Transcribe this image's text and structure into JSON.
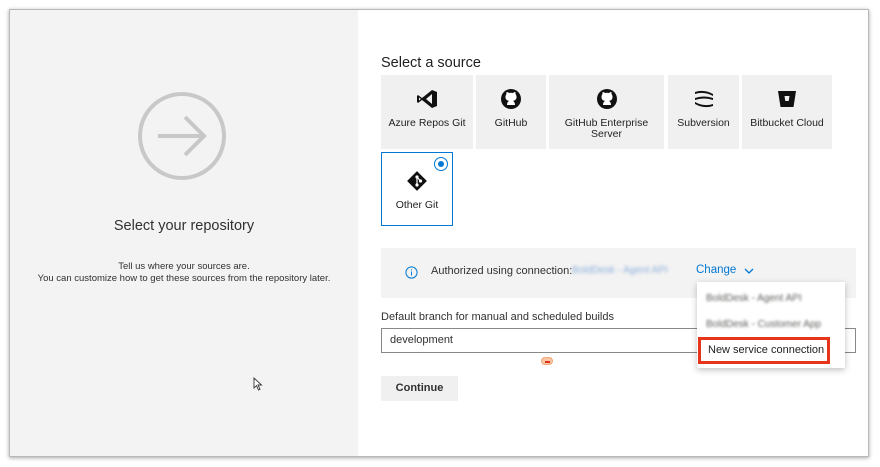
{
  "left_panel": {
    "title": "Select your repository",
    "subtitle_line1": "Tell us where your sources are.",
    "subtitle_line2": "You can customize how to get these sources from the repository later."
  },
  "source_section": {
    "heading": "Select a source",
    "sources": [
      {
        "label": "Azure Repos Git",
        "icon": "azure-repos-icon"
      },
      {
        "label": "GitHub",
        "icon": "github-icon"
      },
      {
        "label": "GitHub Enterprise Server",
        "icon": "github-enterprise-icon"
      },
      {
        "label": "Subversion",
        "icon": "subversion-icon"
      },
      {
        "label": "Bitbucket Cloud",
        "icon": "bitbucket-icon"
      },
      {
        "label": "Other Git",
        "icon": "git-icon",
        "selected": true
      }
    ]
  },
  "authorization": {
    "text": "Authorized using connection:",
    "connection_name": "BoldDesk - Agent API",
    "change_label": "Change"
  },
  "branch": {
    "label": "Default branch for manual and scheduled builds",
    "value": "development"
  },
  "continue_label": "Continue",
  "dropdown": {
    "items": [
      "BoldDesk - Agent API",
      "BoldDesk - Customer App"
    ],
    "new_connection_label": "New service connection"
  },
  "colors": {
    "accent": "#0078d4",
    "highlight": "#e5361c",
    "panel_bg": "#f3f3f3"
  }
}
